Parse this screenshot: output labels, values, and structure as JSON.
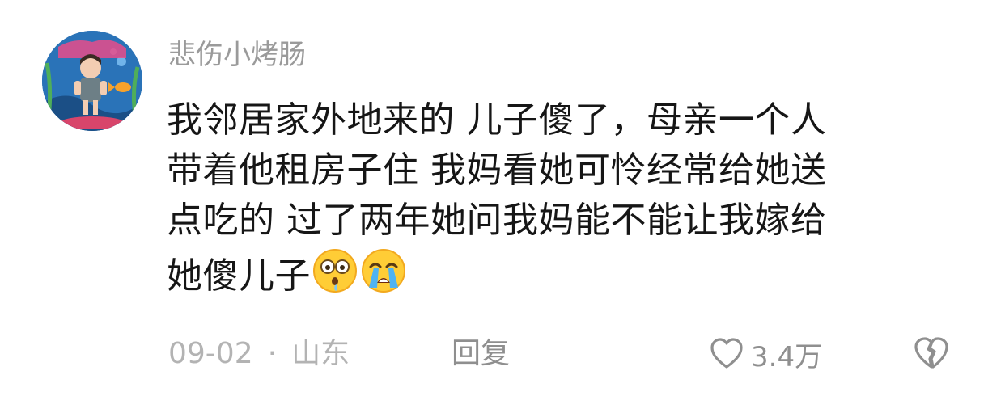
{
  "comment": {
    "username": "悲伤小烤肠",
    "text_lines": [
      "我邻居家外地来的 儿子傻了，母亲一个人",
      "带着他租房子住 我妈看她可怜经常给她送",
      "点吃的 过了两年她问我妈能不能让我嫁给",
      "她傻儿子"
    ],
    "emojis": [
      "drooling-face-emoji",
      "loudly-crying-face-emoji"
    ],
    "date": "09-02",
    "separator": "·",
    "location": "山东",
    "reply_label": "回复",
    "like_count": "3.4万"
  }
}
